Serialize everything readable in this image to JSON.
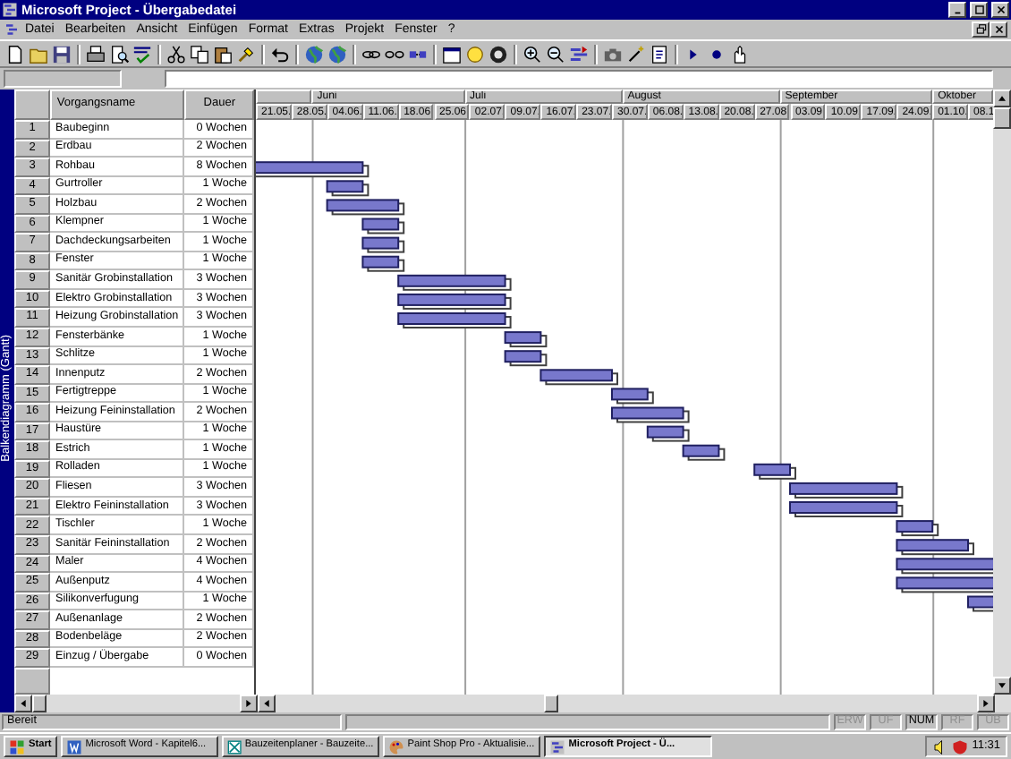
{
  "window": {
    "title": "Microsoft Project - Übergabedatei"
  },
  "menu": [
    "Datei",
    "Bearbeiten",
    "Ansicht",
    "Einfügen",
    "Format",
    "Extras",
    "Projekt",
    "Fenster",
    "?"
  ],
  "view_bar": {
    "label": "Balkendiagramm (Gantt)"
  },
  "table": {
    "columns": [
      "Vorgangsname",
      "Dauer"
    ]
  },
  "timescale": {
    "months": [
      "Juni",
      "Juli",
      "August",
      "September",
      "Oktober"
    ],
    "weeks": [
      "21.05.",
      "28.05.",
      "04.06.",
      "11.06.",
      "18.06.",
      "25.06.",
      "02.07.",
      "09.07.",
      "16.07.",
      "23.07.",
      "30.07.",
      "06.08.",
      "13.08.",
      "20.08.",
      "27.08.",
      "03.09.",
      "10.09.",
      "17.09.",
      "24.09.",
      "01.10.",
      "08.1"
    ]
  },
  "tasks": [
    {
      "id": "1",
      "name": "Baubeginn",
      "duration": "0 Wochen"
    },
    {
      "id": "2",
      "name": "Erdbau",
      "duration": "2 Wochen"
    },
    {
      "id": "3",
      "name": "Rohbau",
      "duration": "8 Wochen"
    },
    {
      "id": "4",
      "name": "Gurtroller",
      "duration": "1 Woche"
    },
    {
      "id": "5",
      "name": "Holzbau",
      "duration": "2 Wochen"
    },
    {
      "id": "6",
      "name": "Klempner",
      "duration": "1 Woche"
    },
    {
      "id": "7",
      "name": "Dachdeckungsarbeiten",
      "duration": "1 Woche"
    },
    {
      "id": "8",
      "name": "Fenster",
      "duration": "1 Woche"
    },
    {
      "id": "9",
      "name": "Sanitär Grobinstallation",
      "duration": "3 Wochen"
    },
    {
      "id": "10",
      "name": "Elektro Grobinstallation",
      "duration": "3 Wochen"
    },
    {
      "id": "11",
      "name": "Heizung Grobinstallation",
      "duration": "3 Wochen"
    },
    {
      "id": "12",
      "name": "Fensterbänke",
      "duration": "1 Woche"
    },
    {
      "id": "13",
      "name": "Schlitze",
      "duration": "1 Woche"
    },
    {
      "id": "14",
      "name": "Innenputz",
      "duration": "2 Wochen"
    },
    {
      "id": "15",
      "name": "Fertigtreppe",
      "duration": "1 Woche"
    },
    {
      "id": "16",
      "name": "Heizung Feininstallation",
      "duration": "2 Wochen"
    },
    {
      "id": "17",
      "name": "Haustüre",
      "duration": "1 Woche"
    },
    {
      "id": "18",
      "name": "Estrich",
      "duration": "1 Woche"
    },
    {
      "id": "19",
      "name": "Rolladen",
      "duration": "1 Woche"
    },
    {
      "id": "20",
      "name": "Fliesen",
      "duration": "3 Wochen"
    },
    {
      "id": "21",
      "name": "Elektro Feininstallation",
      "duration": "3 Wochen"
    },
    {
      "id": "22",
      "name": "Tischler",
      "duration": "1 Woche"
    },
    {
      "id": "23",
      "name": "Sanitär Feininstallation",
      "duration": "2 Wochen"
    },
    {
      "id": "24",
      "name": "Maler",
      "duration": "4 Wochen"
    },
    {
      "id": "25",
      "name": "Außenputz",
      "duration": "4 Wochen"
    },
    {
      "id": "26",
      "name": "Silikonverfugung",
      "duration": "1 Woche"
    },
    {
      "id": "27",
      "name": "Außenanlage",
      "duration": "2 Wochen"
    },
    {
      "id": "28",
      "name": "Bodenbeläge",
      "duration": "2 Wochen"
    },
    {
      "id": "29",
      "name": "Einzug / Übergabe",
      "duration": "0 Wochen"
    }
  ],
  "status_bar": {
    "text": "Bereit",
    "indicators": [
      {
        "label": "ERW",
        "on": false
      },
      {
        "label": "UF",
        "on": false
      },
      {
        "label": "NUM",
        "on": true
      },
      {
        "label": "RF",
        "on": false
      },
      {
        "label": "ÜB",
        "on": false
      }
    ]
  },
  "taskbar": {
    "start": "Start",
    "tasks": [
      {
        "label": "Microsoft Word - Kapitel6...",
        "selected": false
      },
      {
        "label": "Bauzeitenplaner - Bauzeite...",
        "selected": false
      },
      {
        "label": "Paint Shop Pro - Aktualisie...",
        "selected": false
      },
      {
        "label": "Microsoft Project - Ü...",
        "selected": true
      }
    ],
    "clock": "11:31"
  }
}
